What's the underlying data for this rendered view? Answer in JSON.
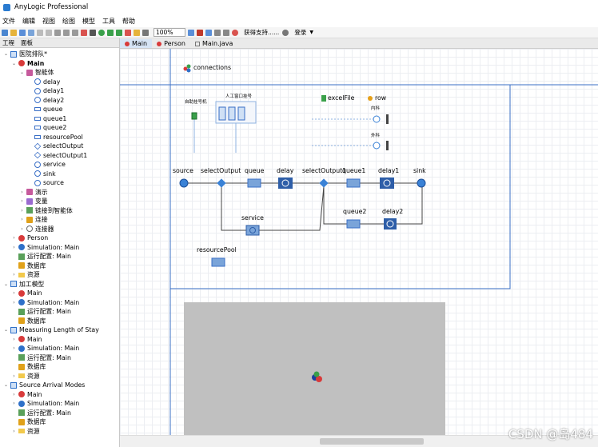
{
  "app": {
    "title": "AnyLogic Professional"
  },
  "menu": [
    "文件",
    "编辑",
    "视图",
    "绘图",
    "模型",
    "工具",
    "帮助"
  ],
  "toolbar": {
    "zoom": "100%",
    "support_label": "获得支持......",
    "login_label": "登录"
  },
  "panel_tabs": [
    "工程",
    "面板"
  ],
  "tree": [
    {
      "label": "医院排队*",
      "depth": 0,
      "icon": "project-icon",
      "expanded": true,
      "bold": false
    },
    {
      "label": "Main",
      "depth": 1,
      "icon": "agent-icon",
      "expanded": true,
      "bold": true
    },
    {
      "label": "智能体",
      "depth": 2,
      "icon": "agent-group-icon",
      "expanded": true,
      "bold": false
    },
    {
      "label": "delay",
      "depth": 3,
      "icon": "delay-icon",
      "bold": false
    },
    {
      "label": "delay1",
      "depth": 3,
      "icon": "delay-icon",
      "bold": false
    },
    {
      "label": "delay2",
      "depth": 3,
      "icon": "delay-icon",
      "bold": false
    },
    {
      "label": "queue",
      "depth": 3,
      "icon": "queue-icon",
      "bold": false
    },
    {
      "label": "queue1",
      "depth": 3,
      "icon": "queue-icon",
      "bold": false
    },
    {
      "label": "queue2",
      "depth": 3,
      "icon": "queue-icon",
      "bold": false
    },
    {
      "label": "resourcePool",
      "depth": 3,
      "icon": "resource-icon",
      "bold": false
    },
    {
      "label": "selectOutput",
      "depth": 3,
      "icon": "select-icon",
      "bold": false
    },
    {
      "label": "selectOutput1",
      "depth": 3,
      "icon": "select-icon",
      "bold": false
    },
    {
      "label": "service",
      "depth": 3,
      "icon": "service-icon",
      "bold": false
    },
    {
      "label": "sink",
      "depth": 3,
      "icon": "sink-icon",
      "bold": false
    },
    {
      "label": "source",
      "depth": 3,
      "icon": "source-icon",
      "bold": false
    },
    {
      "label": "演示",
      "depth": 2,
      "icon": "presentation-icon",
      "expanded": false,
      "bold": false
    },
    {
      "label": "变量",
      "depth": 2,
      "icon": "variable-icon",
      "expanded": false,
      "bold": false
    },
    {
      "label": "链接到智能体",
      "depth": 2,
      "icon": "link-icon",
      "expanded": false,
      "bold": false
    },
    {
      "label": "连接",
      "depth": 2,
      "icon": "connection-icon",
      "expanded": false,
      "bold": false
    },
    {
      "label": "连接器",
      "depth": 2,
      "icon": "connector-icon",
      "expanded": false,
      "bold": false
    },
    {
      "label": "Person",
      "depth": 1,
      "icon": "agent-icon",
      "expanded": false,
      "bold": false
    },
    {
      "label": "Simulation: Main",
      "depth": 1,
      "icon": "simulation-icon",
      "expanded": false,
      "bold": false
    },
    {
      "label": "运行配置: Main",
      "depth": 1,
      "icon": "run-config-icon",
      "bold": false
    },
    {
      "label": "数据库",
      "depth": 1,
      "icon": "database-icon",
      "bold": false
    },
    {
      "label": "资源",
      "depth": 1,
      "icon": "folder-icon",
      "expanded": false,
      "bold": false
    },
    {
      "label": "加工模型",
      "depth": 0,
      "icon": "project-icon",
      "expanded": true,
      "bold": false
    },
    {
      "label": "Main",
      "depth": 1,
      "icon": "agent-icon",
      "expanded": false,
      "bold": false
    },
    {
      "label": "Simulation: Main",
      "depth": 1,
      "icon": "simulation-icon",
      "expanded": false,
      "bold": false
    },
    {
      "label": "运行配置: Main",
      "depth": 1,
      "icon": "run-config-icon",
      "bold": false
    },
    {
      "label": "数据库",
      "depth": 1,
      "icon": "database-icon",
      "bold": false
    },
    {
      "label": "Measuring Length of Stay",
      "depth": 0,
      "icon": "project-icon",
      "expanded": true,
      "bold": false
    },
    {
      "label": "Main",
      "depth": 1,
      "icon": "agent-icon",
      "expanded": false,
      "bold": false
    },
    {
      "label": "Simulation: Main",
      "depth": 1,
      "icon": "simulation-icon",
      "expanded": false,
      "bold": false
    },
    {
      "label": "运行配置: Main",
      "depth": 1,
      "icon": "run-config-icon",
      "bold": false
    },
    {
      "label": "数据库",
      "depth": 1,
      "icon": "database-icon",
      "bold": false
    },
    {
      "label": "资源",
      "depth": 1,
      "icon": "folder-icon",
      "expanded": false,
      "bold": false
    },
    {
      "label": "Source Arrival Modes",
      "depth": 0,
      "icon": "project-icon",
      "expanded": true,
      "bold": false
    },
    {
      "label": "Main",
      "depth": 1,
      "icon": "agent-icon",
      "expanded": false,
      "bold": false
    },
    {
      "label": "Simulation: Main",
      "depth": 1,
      "icon": "simulation-icon",
      "expanded": false,
      "bold": false
    },
    {
      "label": "运行配置: Main",
      "depth": 1,
      "icon": "run-config-icon",
      "bold": false
    },
    {
      "label": "数据库",
      "depth": 1,
      "icon": "database-icon",
      "bold": false
    },
    {
      "label": "资源",
      "depth": 1,
      "icon": "folder-icon",
      "expanded": false,
      "bold": false
    }
  ],
  "editor_tabs": [
    {
      "label": "Main",
      "active": true
    },
    {
      "label": "Person",
      "active": false
    },
    {
      "label": "Main.java",
      "active": false
    }
  ],
  "diagram": {
    "connections_label": "connections",
    "excel_label": "excelFile",
    "row_label": "row",
    "auto_number_label": "自助挂号机",
    "manual_window_label": "人工窗口挂号",
    "internal_label": "内科",
    "surgery_label": "外科",
    "blocks": {
      "source": "source",
      "selectOutput": "selectOutput",
      "queue": "queue",
      "delay": "delay",
      "selectOutput1": "selectOutput1",
      "queue1": "queue1",
      "delay1": "delay1",
      "sink": "sink",
      "service": "service",
      "queue2": "queue2",
      "delay2": "delay2",
      "resourcePool": "resourcePool"
    }
  },
  "watermark": "CSDN @岛484"
}
